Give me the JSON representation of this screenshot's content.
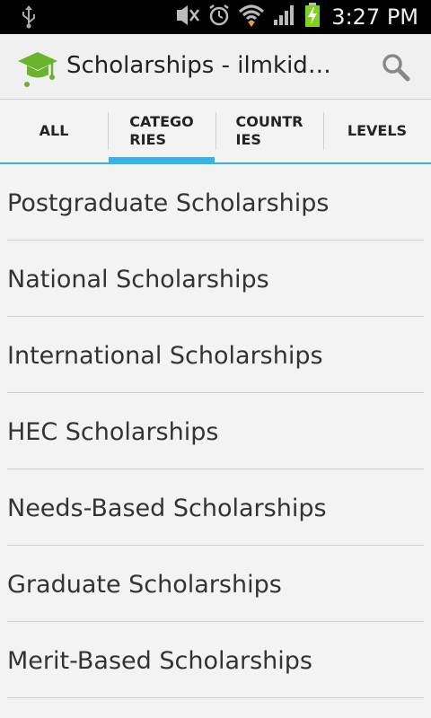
{
  "status_bar": {
    "time": "3:27 PM",
    "icons": [
      "usb-icon",
      "no-signal-mute-icon",
      "alarm-icon",
      "wifi-icon",
      "signal-icon",
      "battery-charging-icon"
    ],
    "battery_color": "#7fd320"
  },
  "action_bar": {
    "title": "Scholarships - ilmkidun…",
    "logo_color": "#6ab42d",
    "search_icon": "search-icon"
  },
  "tabs": [
    {
      "line1": "ALL",
      "line2": "",
      "selected": false
    },
    {
      "line1": "CATEGO",
      "line2": "RIES",
      "selected": true
    },
    {
      "line1": "COUNTR",
      "line2": "IES",
      "selected": false
    },
    {
      "line1": "LEVELS",
      "line2": "",
      "selected": false
    }
  ],
  "accent_color": "#33b5e5",
  "categories": [
    "Postgraduate Scholarships",
    "National Scholarships",
    "International Scholarships",
    "HEC Scholarships",
    "Needs-Based Scholarships",
    "Graduate Scholarships",
    "Merit-Based Scholarships"
  ]
}
